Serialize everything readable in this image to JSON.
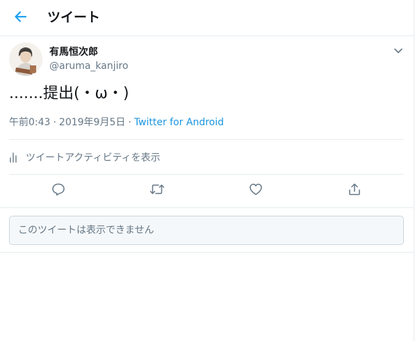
{
  "header": {
    "title": "ツイート",
    "back_icon": "arrow-left-icon"
  },
  "tweet": {
    "author_name": "有馬恒次郎",
    "author_handle": "@aruma_kanjiro",
    "text": ".......提出(・ω・)",
    "time": "午前0:43",
    "separator": "·",
    "date": "2019年9月5日",
    "source": "Twitter for Android"
  },
  "activity": {
    "label": "ツイートアクティビティを表示",
    "icon": "bar-chart-icon"
  },
  "actions": {
    "reply_icon": "reply-icon",
    "retweet_icon": "retweet-icon",
    "like_icon": "heart-icon",
    "share_icon": "share-icon"
  },
  "quoted": {
    "unavailable_text": "このツイートは表示できません"
  },
  "colors": {
    "accent": "#1da1f2",
    "link": "#1b95e0",
    "secondary_text": "#657786",
    "border": "#e6ecf0"
  }
}
